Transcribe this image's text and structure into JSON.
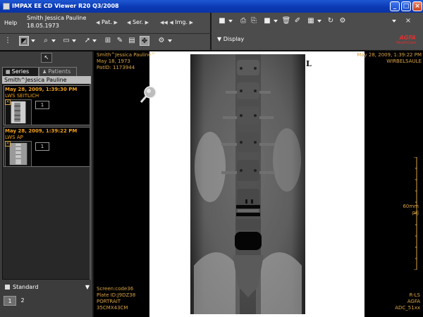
{
  "window": {
    "title": "IMPAX EE CD Viewer   R20 Q3/2008",
    "controls": {
      "minimize": "_",
      "maximize": "□",
      "close": "×"
    }
  },
  "toolbar": {
    "help_label": "Help",
    "patient_name": "Smith Jessica Pauline",
    "patient_dob": "18.05.1973",
    "nav": {
      "pat_label": "Pat.",
      "ser_label": "Ser.",
      "img_label": "Img."
    },
    "display_label": "Display",
    "brand": "AGFA",
    "brand_sub": "HealthCare",
    "icons": [
      "layout-icon",
      "zoom-icon",
      "page-icon",
      "pointer-icon",
      "measure-icon",
      "annotate-icon",
      "window-level-icon",
      "pan-icon",
      "cine-icon"
    ]
  },
  "left_panel": {
    "tabs": [
      {
        "label": "Series",
        "icon": "series-icon",
        "active": true
      },
      {
        "label": "Patients",
        "icon": "patients-icon",
        "active": false
      }
    ],
    "patient_header": "Smith^Jessica Pauline",
    "series": [
      {
        "datetime": "May 28, 2009, 1:39:30 PM",
        "description": "LWS SEITLICH",
        "count": "1",
        "checked": true
      },
      {
        "datetime": "May 28, 2009, 1:39:22 PM",
        "description": "LWS AP",
        "count": "1",
        "checked": true
      }
    ],
    "layout_select": "Standard",
    "pages": [
      "1",
      "2"
    ],
    "active_page": "1"
  },
  "viewer": {
    "overlay_top_left": [
      "Smith^Jessica Pauline^",
      "May 18, 1973",
      "PatID: 1173944"
    ],
    "overlay_top_right": [
      "May 28, 2009, 1:39:22 PM",
      "WIRBELSAULE"
    ],
    "overlay_bottom_left": [
      "Screen:code36",
      "Plate ID:J9DZ38",
      "PORTRAIT",
      "35CMX43CM"
    ],
    "overlay_bottom_right": [
      "R-LS",
      "AGFA",
      "ADC_51xx"
    ],
    "scale_label": "60mm",
    "scale_unit": "prj",
    "orientation_marker": "L"
  }
}
